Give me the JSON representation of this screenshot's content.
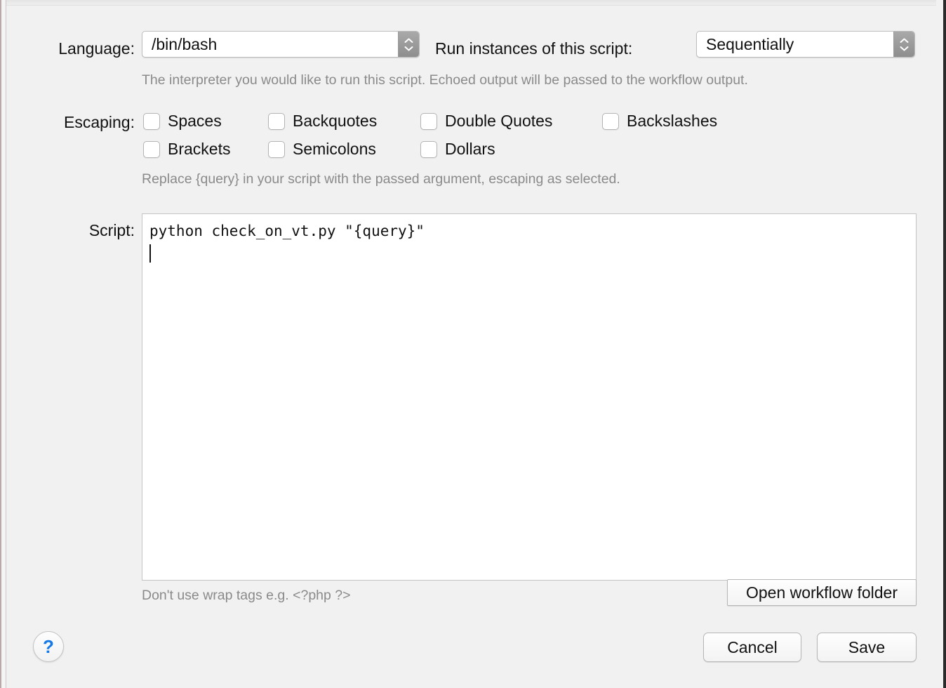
{
  "dialog": {
    "language": {
      "label": "Language:",
      "value": "/bin/bash",
      "stepper_icon": "chevron-up-down-icon"
    },
    "run_instances": {
      "label": "Run instances of this script:",
      "value": "Sequentially",
      "stepper_icon": "chevron-up-down-icon"
    },
    "language_hint": "The interpreter you would like to run this script. Echoed output will be passed to the workflow output.",
    "escaping": {
      "label": "Escaping:",
      "options": [
        {
          "name": "spaces",
          "label": "Spaces",
          "checked": false
        },
        {
          "name": "backquotes",
          "label": "Backquotes",
          "checked": false
        },
        {
          "name": "double-quotes",
          "label": "Double Quotes",
          "checked": false
        },
        {
          "name": "backslashes",
          "label": "Backslashes",
          "checked": false
        },
        {
          "name": "brackets",
          "label": "Brackets",
          "checked": false
        },
        {
          "name": "semicolons",
          "label": "Semicolons",
          "checked": false
        },
        {
          "name": "dollars",
          "label": "Dollars",
          "checked": false
        }
      ],
      "hint": "Replace {query} in your script with the passed argument, escaping as selected."
    },
    "script": {
      "label": "Script:",
      "value": "python check_on_vt.py \"{query}\"",
      "placeholder": "",
      "hint": "Don't use wrap tags e.g. <?php ?>"
    },
    "buttons": {
      "open_workflow_folder": "Open workflow folder",
      "cancel": "Cancel",
      "save": "Save",
      "help": "?"
    },
    "colors": {
      "background": "#f1f1f1",
      "text": "#111111",
      "hint_text": "#8a8a8a",
      "help_accent": "#1479e8",
      "stepper": "#9a9a9a"
    }
  }
}
